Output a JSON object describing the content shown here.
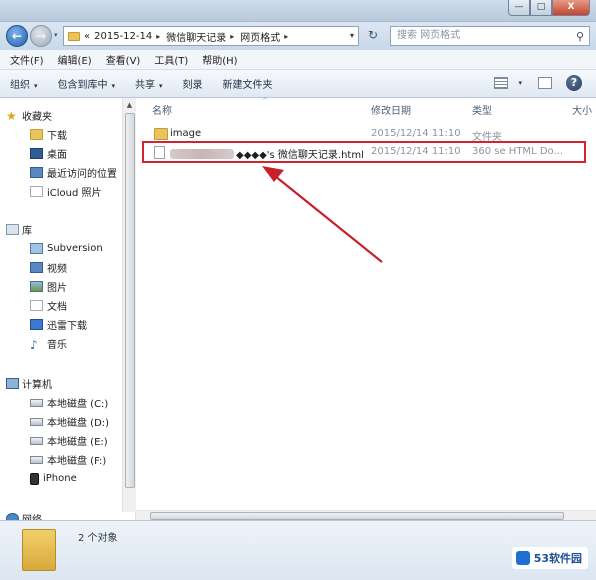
{
  "window": {
    "controls": {
      "minimize": "—",
      "maximize": "□",
      "close": "X"
    }
  },
  "address": {
    "back_glyph": "←",
    "forward_glyph": "→",
    "prefix": "«",
    "crumbs": [
      "2015-12-14",
      "微信聊天记录",
      "网页格式"
    ],
    "sep": "▸",
    "dropdown": "▾",
    "refresh_glyph": "↻",
    "search_placeholder": "搜索 网页格式"
  },
  "menubar": {
    "items": [
      "文件(F)",
      "编辑(E)",
      "查看(V)",
      "工具(T)",
      "帮助(H)"
    ]
  },
  "toolbar": {
    "organize": "组织",
    "include_library": "包含到库中",
    "share": "共享",
    "burn": "刻录",
    "new_folder": "新建文件夹",
    "arrow": "▾",
    "help": "?"
  },
  "navigation": {
    "favorites": {
      "label": "收藏夹",
      "items": [
        "下载",
        "桌面",
        "最近访问的位置",
        "iCloud 照片"
      ]
    },
    "libraries": {
      "label": "库",
      "items": [
        "Subversion",
        "视频",
        "图片",
        "文档",
        "迅雷下载",
        "音乐"
      ]
    },
    "computer": {
      "label": "计算机",
      "items": [
        "本地磁盘 (C:)",
        "本地磁盘 (D:)",
        "本地磁盘 (E:)",
        "本地磁盘 (F:)",
        "iPhone"
      ]
    },
    "network": {
      "label": "网络"
    }
  },
  "columns": {
    "name": "名称",
    "date": "修改日期",
    "type": "类型",
    "size": "大小"
  },
  "files": [
    {
      "name": "image",
      "date": "2015/12/14 11:10",
      "type": "文件夹",
      "kind": "folder"
    },
    {
      "name": "◆◆◆◆'s 微信聊天记录.html",
      "date": "2015/12/14 11:10",
      "type": "360 se HTML Do...",
      "kind": "html",
      "redacted_prefix": true
    }
  ],
  "status": {
    "count": "2 个对象"
  },
  "watermark": {
    "text": "53软件园"
  },
  "colors": {
    "highlight_box": "#d8222b",
    "arrow": "#c8202a"
  }
}
